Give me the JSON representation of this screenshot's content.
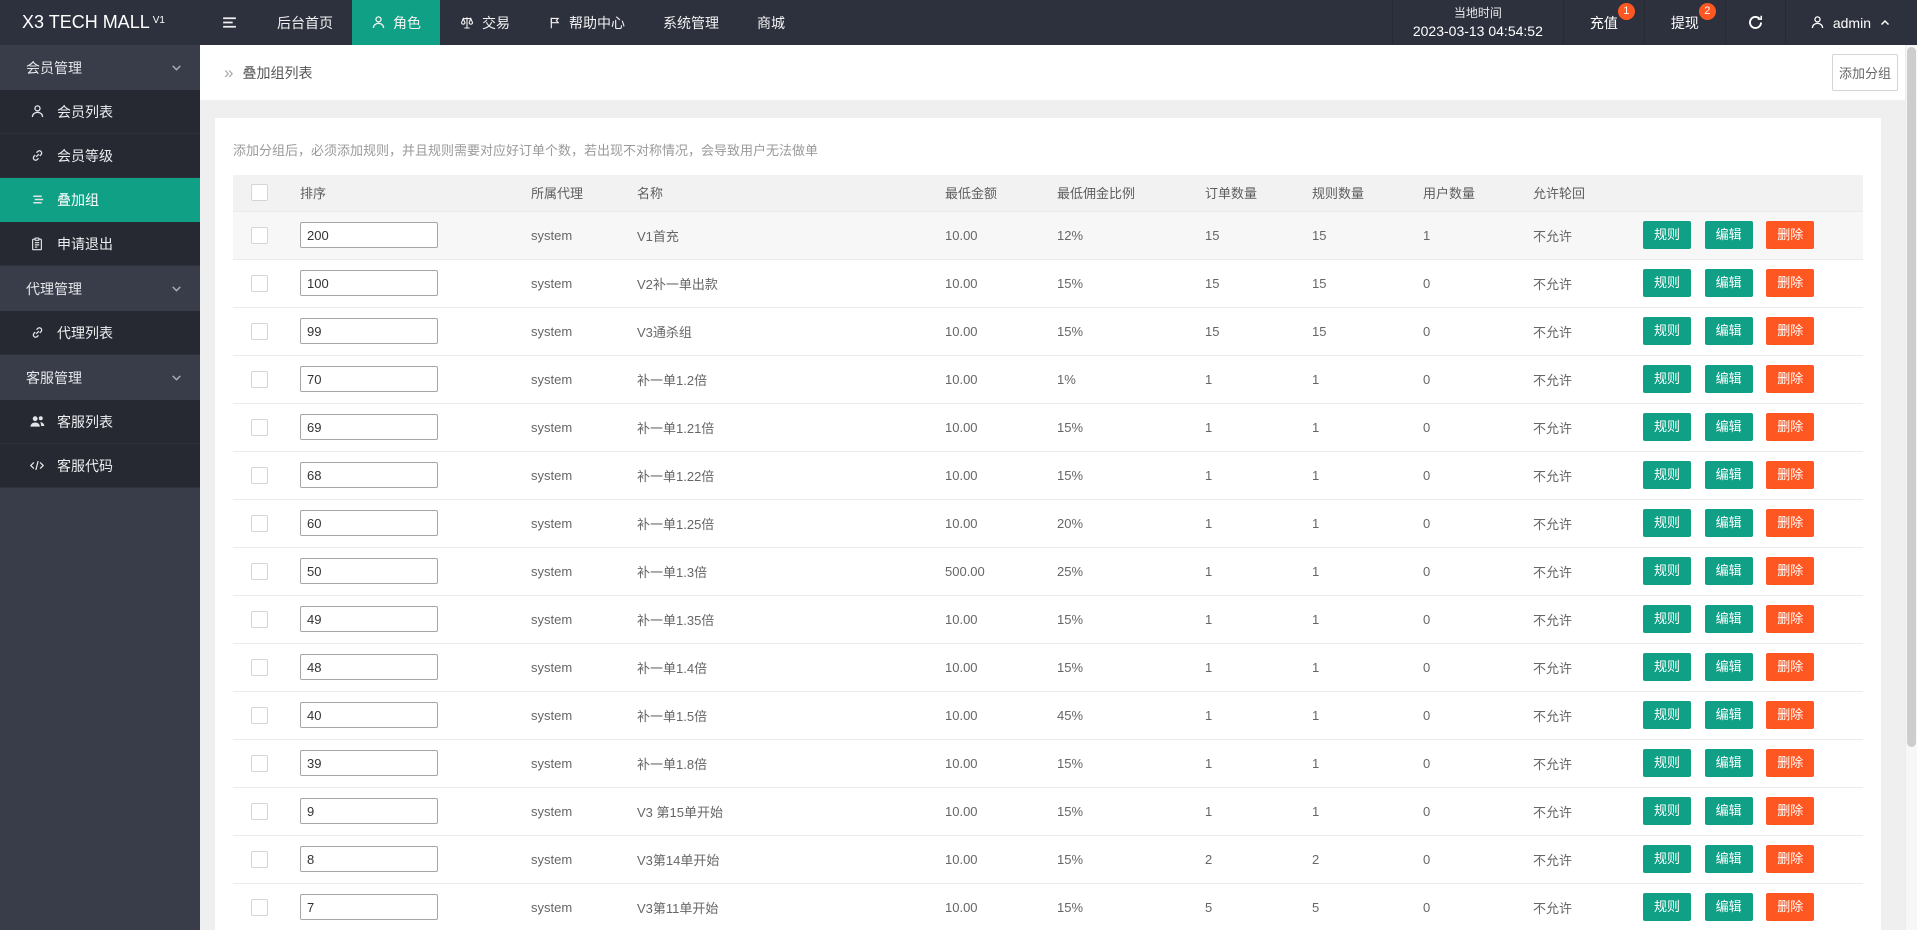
{
  "colors": {
    "accent_teal": "#10a086",
    "danger_orange": "#ff5722",
    "navbar_bg": "#2d313d",
    "sidebar_bg": "#393d49"
  },
  "navbar": {
    "logo": "X3 TECH MALL",
    "logo_version": "V1",
    "items": [
      {
        "key": "home",
        "label": "后台首页",
        "icon": null,
        "active": false
      },
      {
        "key": "role",
        "label": "角色",
        "icon": "user",
        "active": true
      },
      {
        "key": "trade",
        "label": "交易",
        "icon": "scales",
        "active": false
      },
      {
        "key": "help",
        "label": "帮助中心",
        "icon": "flag",
        "active": false
      },
      {
        "key": "system",
        "label": "系统管理",
        "icon": null,
        "active": false
      },
      {
        "key": "mall",
        "label": "商城",
        "icon": null,
        "active": false
      }
    ],
    "local_time_label": "当地时间",
    "local_time_value": "2023-03-13 04:54:52",
    "recharge": {
      "label": "充值",
      "badge": "1"
    },
    "withdraw": {
      "label": "提现",
      "badge": "2"
    },
    "admin_name": "admin"
  },
  "sidebar": {
    "groups": [
      {
        "key": "member-mgmt",
        "label": "会员管理",
        "items": [
          {
            "key": "member-list",
            "label": "会员列表",
            "icon": "person",
            "active": false
          },
          {
            "key": "member-level",
            "label": "会员等级",
            "icon": "link",
            "active": false
          },
          {
            "key": "stack-group",
            "label": "叠加组",
            "icon": "list",
            "active": true
          },
          {
            "key": "apply-exit",
            "label": "申请退出",
            "icon": "clipboard",
            "active": false
          }
        ]
      },
      {
        "key": "agent-mgmt",
        "label": "代理管理",
        "items": [
          {
            "key": "agent-list",
            "label": "代理列表",
            "icon": "link",
            "active": false
          }
        ]
      },
      {
        "key": "service-mgmt",
        "label": "客服管理",
        "items": [
          {
            "key": "service-list",
            "label": "客服列表",
            "icon": "users",
            "active": false
          },
          {
            "key": "service-code",
            "label": "客服代码",
            "icon": "code",
            "active": false
          }
        ]
      }
    ]
  },
  "page": {
    "breadcrumb_icon": "»",
    "breadcrumb": "叠加组列表",
    "add_group_button": "添加分组",
    "hint": "添加分组后，必须添加规则，并且规则需要对应好订单个数，若出现不对称情况，会导致用户无法做单"
  },
  "table": {
    "headers": [
      "排序",
      "所属代理",
      "名称",
      "最低金额",
      "最低佣金比例",
      "订单数量",
      "规则数量",
      "用户数量",
      "允许轮回"
    ],
    "action_labels": {
      "rule": "规则",
      "edit": "编辑",
      "delete": "删除"
    },
    "rows": [
      {
        "sort": "200",
        "agent": "system",
        "name": "V1首充",
        "min_amount": "10.00",
        "min_commission": "12%",
        "orders": "15",
        "rules": "15",
        "users": "1",
        "loop": "不允许"
      },
      {
        "sort": "100",
        "agent": "system",
        "name": "V2补一单出款",
        "min_amount": "10.00",
        "min_commission": "15%",
        "orders": "15",
        "rules": "15",
        "users": "0",
        "loop": "不允许"
      },
      {
        "sort": "99",
        "agent": "system",
        "name": "V3通杀组",
        "min_amount": "10.00",
        "min_commission": "15%",
        "orders": "15",
        "rules": "15",
        "users": "0",
        "loop": "不允许"
      },
      {
        "sort": "70",
        "agent": "system",
        "name": "补一单1.2倍",
        "min_amount": "10.00",
        "min_commission": "1%",
        "orders": "1",
        "rules": "1",
        "users": "0",
        "loop": "不允许"
      },
      {
        "sort": "69",
        "agent": "system",
        "name": "补一单1.21倍",
        "min_amount": "10.00",
        "min_commission": "15%",
        "orders": "1",
        "rules": "1",
        "users": "0",
        "loop": "不允许"
      },
      {
        "sort": "68",
        "agent": "system",
        "name": "补一单1.22倍",
        "min_amount": "10.00",
        "min_commission": "15%",
        "orders": "1",
        "rules": "1",
        "users": "0",
        "loop": "不允许"
      },
      {
        "sort": "60",
        "agent": "system",
        "name": "补一单1.25倍",
        "min_amount": "10.00",
        "min_commission": "20%",
        "orders": "1",
        "rules": "1",
        "users": "0",
        "loop": "不允许"
      },
      {
        "sort": "50",
        "agent": "system",
        "name": "补一单1.3倍",
        "min_amount": "500.00",
        "min_commission": "25%",
        "orders": "1",
        "rules": "1",
        "users": "0",
        "loop": "不允许"
      },
      {
        "sort": "49",
        "agent": "system",
        "name": "补一单1.35倍",
        "min_amount": "10.00",
        "min_commission": "15%",
        "orders": "1",
        "rules": "1",
        "users": "0",
        "loop": "不允许"
      },
      {
        "sort": "48",
        "agent": "system",
        "name": "补一单1.4倍",
        "min_amount": "10.00",
        "min_commission": "15%",
        "orders": "1",
        "rules": "1",
        "users": "0",
        "loop": "不允许"
      },
      {
        "sort": "40",
        "agent": "system",
        "name": "补一单1.5倍",
        "min_amount": "10.00",
        "min_commission": "45%",
        "orders": "1",
        "rules": "1",
        "users": "0",
        "loop": "不允许"
      },
      {
        "sort": "39",
        "agent": "system",
        "name": "补一单1.8倍",
        "min_amount": "10.00",
        "min_commission": "15%",
        "orders": "1",
        "rules": "1",
        "users": "0",
        "loop": "不允许"
      },
      {
        "sort": "9",
        "agent": "system",
        "name": "V3 第15单开始",
        "min_amount": "10.00",
        "min_commission": "15%",
        "orders": "1",
        "rules": "1",
        "users": "0",
        "loop": "不允许"
      },
      {
        "sort": "8",
        "agent": "system",
        "name": "V3第14单开始",
        "min_amount": "10.00",
        "min_commission": "15%",
        "orders": "2",
        "rules": "2",
        "users": "0",
        "loop": "不允许"
      },
      {
        "sort": "7",
        "agent": "system",
        "name": "V3第11单开始",
        "min_amount": "10.00",
        "min_commission": "15%",
        "orders": "5",
        "rules": "5",
        "users": "0",
        "loop": "不允许"
      }
    ]
  }
}
